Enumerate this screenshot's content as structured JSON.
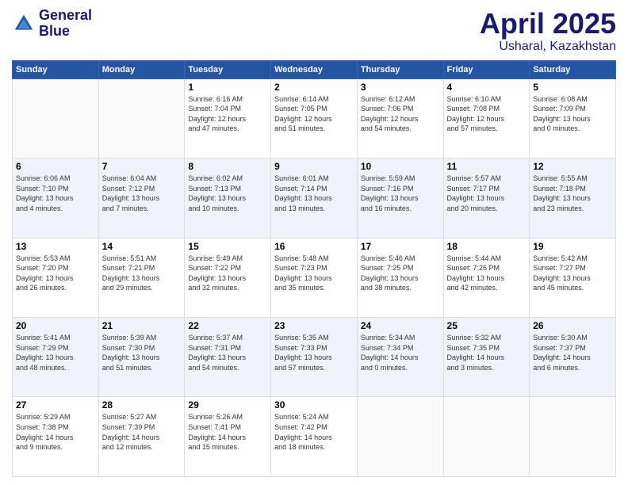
{
  "header": {
    "logo_line1": "General",
    "logo_line2": "Blue",
    "month_title": "April 2025",
    "location": "Usharal, Kazakhstan"
  },
  "days_of_week": [
    "Sunday",
    "Monday",
    "Tuesday",
    "Wednesday",
    "Thursday",
    "Friday",
    "Saturday"
  ],
  "weeks": [
    {
      "shade": "white",
      "days": [
        {
          "num": "",
          "info": ""
        },
        {
          "num": "",
          "info": ""
        },
        {
          "num": "1",
          "info": "Sunrise: 6:16 AM\nSunset: 7:04 PM\nDaylight: 12 hours\nand 47 minutes."
        },
        {
          "num": "2",
          "info": "Sunrise: 6:14 AM\nSunset: 7:05 PM\nDaylight: 12 hours\nand 51 minutes."
        },
        {
          "num": "3",
          "info": "Sunrise: 6:12 AM\nSunset: 7:06 PM\nDaylight: 12 hours\nand 54 minutes."
        },
        {
          "num": "4",
          "info": "Sunrise: 6:10 AM\nSunset: 7:08 PM\nDaylight: 12 hours\nand 57 minutes."
        },
        {
          "num": "5",
          "info": "Sunrise: 6:08 AM\nSunset: 7:09 PM\nDaylight: 13 hours\nand 0 minutes."
        }
      ]
    },
    {
      "shade": "shaded",
      "days": [
        {
          "num": "6",
          "info": "Sunrise: 6:06 AM\nSunset: 7:10 PM\nDaylight: 13 hours\nand 4 minutes."
        },
        {
          "num": "7",
          "info": "Sunrise: 6:04 AM\nSunset: 7:12 PM\nDaylight: 13 hours\nand 7 minutes."
        },
        {
          "num": "8",
          "info": "Sunrise: 6:02 AM\nSunset: 7:13 PM\nDaylight: 13 hours\nand 10 minutes."
        },
        {
          "num": "9",
          "info": "Sunrise: 6:01 AM\nSunset: 7:14 PM\nDaylight: 13 hours\nand 13 minutes."
        },
        {
          "num": "10",
          "info": "Sunrise: 5:59 AM\nSunset: 7:16 PM\nDaylight: 13 hours\nand 16 minutes."
        },
        {
          "num": "11",
          "info": "Sunrise: 5:57 AM\nSunset: 7:17 PM\nDaylight: 13 hours\nand 20 minutes."
        },
        {
          "num": "12",
          "info": "Sunrise: 5:55 AM\nSunset: 7:18 PM\nDaylight: 13 hours\nand 23 minutes."
        }
      ]
    },
    {
      "shade": "white",
      "days": [
        {
          "num": "13",
          "info": "Sunrise: 5:53 AM\nSunset: 7:20 PM\nDaylight: 13 hours\nand 26 minutes."
        },
        {
          "num": "14",
          "info": "Sunrise: 5:51 AM\nSunset: 7:21 PM\nDaylight: 13 hours\nand 29 minutes."
        },
        {
          "num": "15",
          "info": "Sunrise: 5:49 AM\nSunset: 7:22 PM\nDaylight: 13 hours\nand 32 minutes."
        },
        {
          "num": "16",
          "info": "Sunrise: 5:48 AM\nSunset: 7:23 PM\nDaylight: 13 hours\nand 35 minutes."
        },
        {
          "num": "17",
          "info": "Sunrise: 5:46 AM\nSunset: 7:25 PM\nDaylight: 13 hours\nand 38 minutes."
        },
        {
          "num": "18",
          "info": "Sunrise: 5:44 AM\nSunset: 7:26 PM\nDaylight: 13 hours\nand 42 minutes."
        },
        {
          "num": "19",
          "info": "Sunrise: 5:42 AM\nSunset: 7:27 PM\nDaylight: 13 hours\nand 45 minutes."
        }
      ]
    },
    {
      "shade": "shaded",
      "days": [
        {
          "num": "20",
          "info": "Sunrise: 5:41 AM\nSunset: 7:29 PM\nDaylight: 13 hours\nand 48 minutes."
        },
        {
          "num": "21",
          "info": "Sunrise: 5:39 AM\nSunset: 7:30 PM\nDaylight: 13 hours\nand 51 minutes."
        },
        {
          "num": "22",
          "info": "Sunrise: 5:37 AM\nSunset: 7:31 PM\nDaylight: 13 hours\nand 54 minutes."
        },
        {
          "num": "23",
          "info": "Sunrise: 5:35 AM\nSunset: 7:33 PM\nDaylight: 13 hours\nand 57 minutes."
        },
        {
          "num": "24",
          "info": "Sunrise: 5:34 AM\nSunset: 7:34 PM\nDaylight: 14 hours\nand 0 minutes."
        },
        {
          "num": "25",
          "info": "Sunrise: 5:32 AM\nSunset: 7:35 PM\nDaylight: 14 hours\nand 3 minutes."
        },
        {
          "num": "26",
          "info": "Sunrise: 5:30 AM\nSunset: 7:37 PM\nDaylight: 14 hours\nand 6 minutes."
        }
      ]
    },
    {
      "shade": "white",
      "days": [
        {
          "num": "27",
          "info": "Sunrise: 5:29 AM\nSunset: 7:38 PM\nDaylight: 14 hours\nand 9 minutes."
        },
        {
          "num": "28",
          "info": "Sunrise: 5:27 AM\nSunset: 7:39 PM\nDaylight: 14 hours\nand 12 minutes."
        },
        {
          "num": "29",
          "info": "Sunrise: 5:26 AM\nSunset: 7:41 PM\nDaylight: 14 hours\nand 15 minutes."
        },
        {
          "num": "30",
          "info": "Sunrise: 5:24 AM\nSunset: 7:42 PM\nDaylight: 14 hours\nand 18 minutes."
        },
        {
          "num": "",
          "info": ""
        },
        {
          "num": "",
          "info": ""
        },
        {
          "num": "",
          "info": ""
        }
      ]
    }
  ]
}
